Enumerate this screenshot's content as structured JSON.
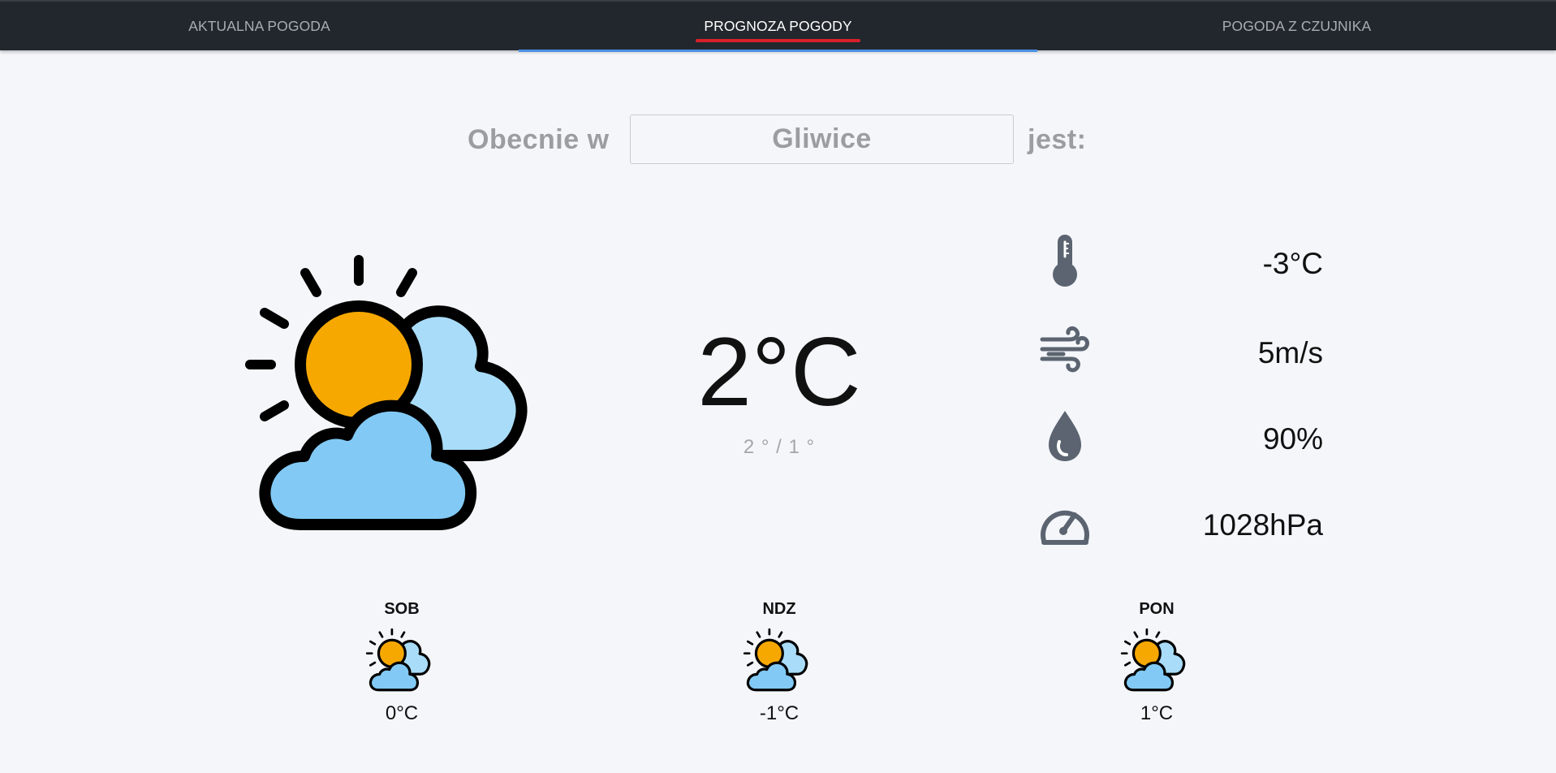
{
  "nav": {
    "tabs": [
      {
        "label": "AKTUALNA POGODA",
        "active": false
      },
      {
        "label": "PROGNOZA POGODY",
        "active": true
      },
      {
        "label": "POGODA Z CZUJNIKA",
        "active": false
      }
    ]
  },
  "search": {
    "prefix": "Obecnie w",
    "city": "Gliwice",
    "suffix": "jest:"
  },
  "current": {
    "icon": "partly-cloudy-icon",
    "temperature": "2°C",
    "range": "2 ° / 1 °"
  },
  "stats": [
    {
      "icon": "thermometer-icon",
      "value": "-3°C"
    },
    {
      "icon": "wind-icon",
      "value": "5m/s"
    },
    {
      "icon": "humidity-drop-icon",
      "value": "90%"
    },
    {
      "icon": "pressure-gauge-icon",
      "value": "1028hPa"
    }
  ],
  "forecast": [
    {
      "day": "SOB",
      "icon": "partly-cloudy-icon",
      "temp": "0°C"
    },
    {
      "day": "NDZ",
      "icon": "partly-cloudy-icon",
      "temp": "-1°C"
    },
    {
      "day": "PON",
      "icon": "partly-cloudy-icon",
      "temp": "1°C"
    }
  ],
  "colors": {
    "topbar": "#22272d",
    "active_underline": "#d8202a",
    "tab_indicator": "#4a90e2",
    "sun": "#f7a800",
    "cloud_front": "#82caf5",
    "cloud_back": "#a9dcf8",
    "stat_icon": "#5b6470"
  }
}
